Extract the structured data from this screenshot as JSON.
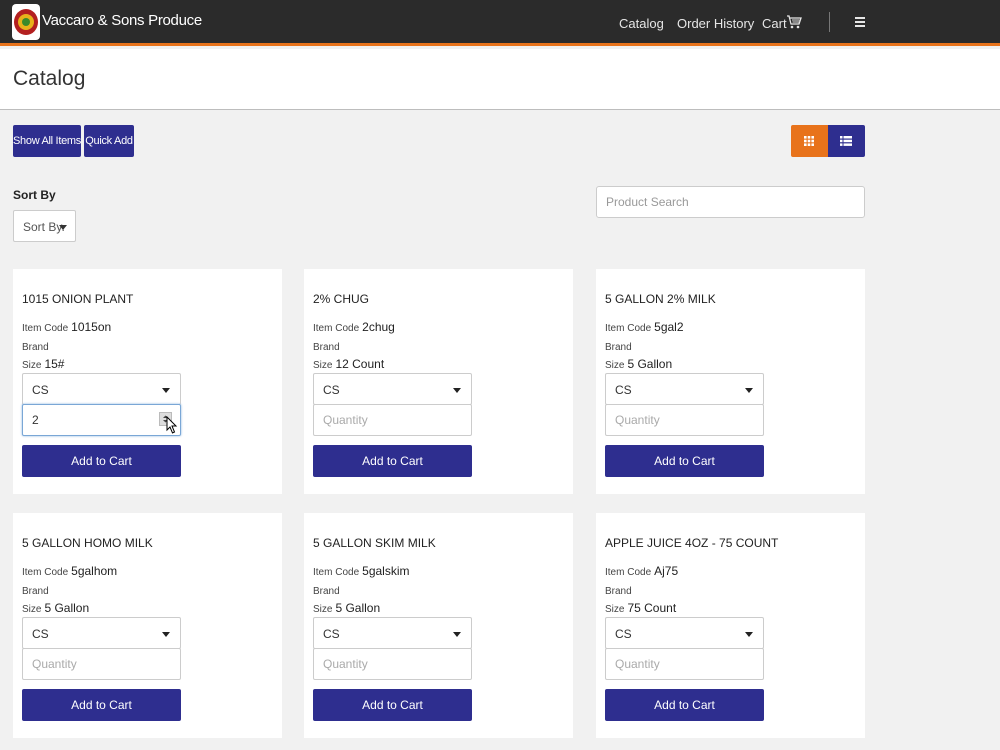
{
  "app": {
    "brand": "Vaccaro & Sons Produce",
    "nav": [
      {
        "label": "Catalog"
      },
      {
        "label": "Order History"
      },
      {
        "label": "Cart"
      }
    ],
    "icons": {
      "logo": "company-logo",
      "cart": "cart-icon",
      "menu": "hamburger-menu-icon"
    },
    "colors": {
      "accent": "#e8731b",
      "primary": "#2e2e8f",
      "topbar": "#2b2b2b"
    }
  },
  "page": {
    "title": "Catalog"
  },
  "toolbar": {
    "show_all_label": "Show All Items",
    "quick_add_label": "Quick Add",
    "view_modes": [
      {
        "name": "grid",
        "icon": "grid-view-icon",
        "active": true
      },
      {
        "name": "list",
        "icon": "list-view-icon",
        "active": false
      }
    ]
  },
  "sort": {
    "label": "Sort By",
    "selected": "Sort By."
  },
  "search": {
    "placeholder": "Product Search",
    "value": ""
  },
  "labels": {
    "item_code": "Item Code",
    "brand": "Brand",
    "size": "Size",
    "add_to_cart": "Add to Cart",
    "quantity_placeholder": "Quantity"
  },
  "products": [
    {
      "name": "1015 ONION PLANT",
      "item_code": "1015on",
      "brand": "",
      "size": "15#",
      "unit": "CS",
      "quantity": "2"
    },
    {
      "name": "2% CHUG",
      "item_code": "2chug",
      "brand": "",
      "size": "12 Count",
      "unit": "CS",
      "quantity": ""
    },
    {
      "name": "5 GALLON 2% MILK",
      "item_code": "5gal2",
      "brand": "",
      "size": "5 Gallon",
      "unit": "CS",
      "quantity": ""
    },
    {
      "name": "5 GALLON HOMO MILK",
      "item_code": "5galhom",
      "brand": "",
      "size": "5 Gallon",
      "unit": "CS",
      "quantity": ""
    },
    {
      "name": "5 GALLON SKIM MILK",
      "item_code": "5galskim",
      "brand": "",
      "size": "5 Gallon",
      "unit": "CS",
      "quantity": ""
    },
    {
      "name": "APPLE JUICE 4OZ - 75 COUNT",
      "item_code": "Aj75",
      "brand": "",
      "size": "75 Count",
      "unit": "CS",
      "quantity": ""
    }
  ]
}
